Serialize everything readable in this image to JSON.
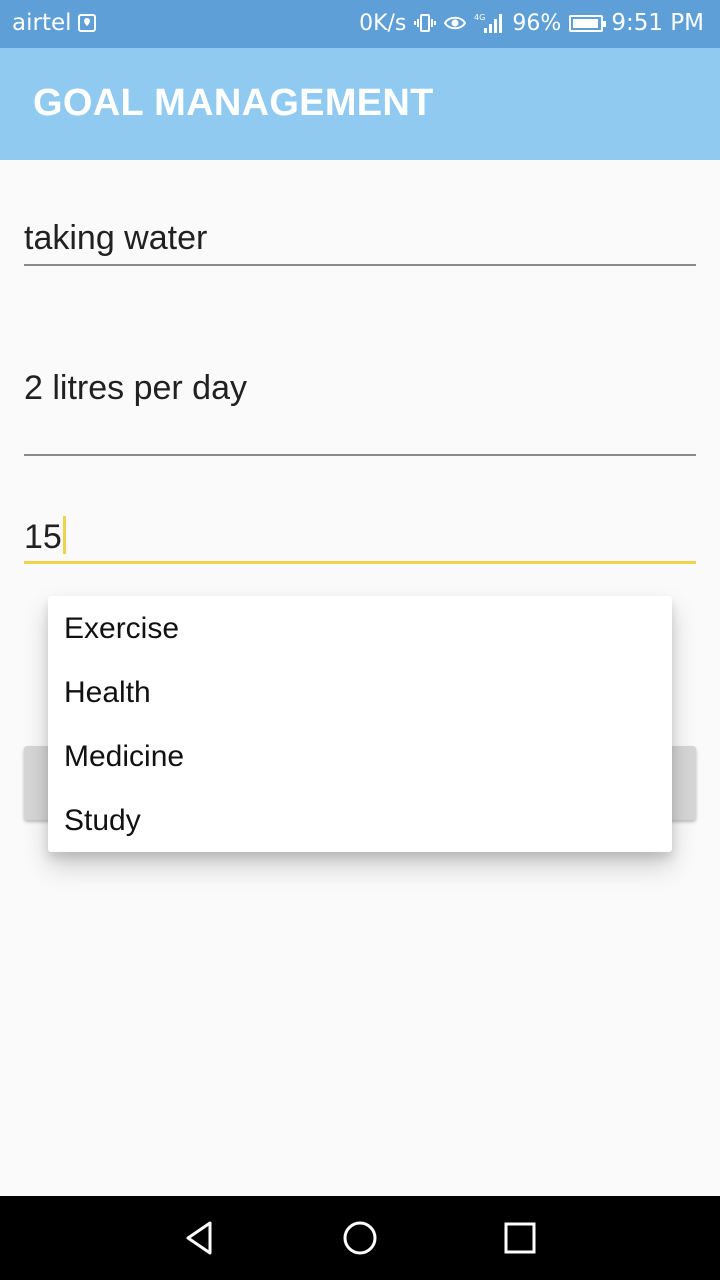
{
  "status_bar": {
    "carrier": "airtel",
    "net_speed": "0K/s",
    "network_type": "4G",
    "battery_percent": "96%",
    "time": "9:51 PM",
    "icons": [
      "location-icon",
      "vibrate-icon",
      "eye-icon",
      "signal-icon",
      "battery-icon"
    ]
  },
  "app_bar": {
    "title": "GOAL MANAGEMENT"
  },
  "form": {
    "goal_name": "taking water",
    "goal_target": "2 litres per day",
    "goal_days": "15"
  },
  "dropdown": {
    "options": [
      "Exercise",
      "Health",
      "Medicine",
      "Study"
    ]
  },
  "nav_bar": {
    "buttons": [
      "back-icon",
      "home-icon",
      "recents-icon"
    ]
  },
  "colors": {
    "status_bar": "#5d9fd6",
    "app_bar": "#90caf1",
    "accent": "#f0d34a",
    "background": "#fafafa"
  }
}
